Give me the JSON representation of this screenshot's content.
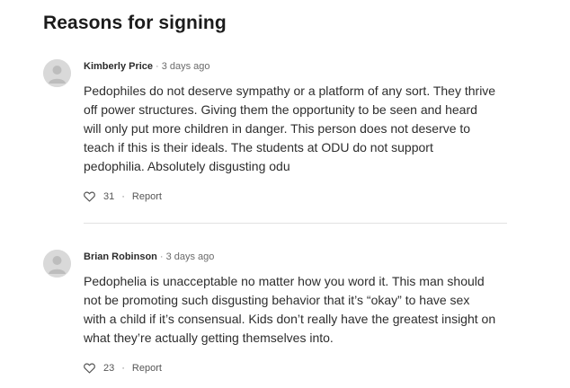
{
  "section": {
    "title": "Reasons for signing"
  },
  "comments": [
    {
      "author": "Kimberly Price",
      "separator": "·",
      "time": "3 days ago",
      "body_lines": [
        "Pedophiles do not deserve sympathy or a platform of any sort. They thrive",
        "off power structures. Giving them the opportunity to be seen and heard",
        "will only put more children in danger. This person does not deserve to",
        "teach if this is their ideals. The students at ODU do not support",
        "pedophilia. Absolutely disgusting odu"
      ],
      "likes": "31",
      "dot": "·",
      "report_label": "Report"
    },
    {
      "author": "Brian Robinson",
      "separator": "·",
      "time": "3 days ago",
      "body_lines": [
        "Pedophelia is unacceptable no matter how you word it. This man should",
        "not be promoting such disgusting behavior that it’s “okay” to have sex",
        "with a child if it’s consensual. Kids don’t really have the greatest insight on",
        "what they’re actually getting themselves into."
      ],
      "likes": "23",
      "dot": "·",
      "report_label": "Report"
    }
  ],
  "icons": {
    "avatar": "user-avatar-icon",
    "like": "heart-icon"
  },
  "colors": {
    "avatar_bg": "#d9d9d9",
    "avatar_fg": "#bdbdbd",
    "divider": "#e2e2e2"
  }
}
